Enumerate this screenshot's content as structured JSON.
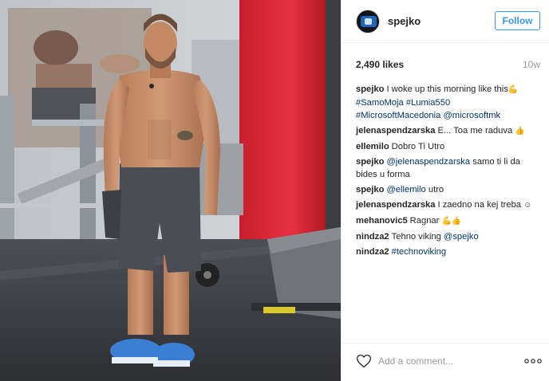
{
  "post": {
    "photo_alt": "",
    "author": {
      "username": "spejko",
      "avatar_icon": "profile-avatar"
    },
    "follow_label": "Follow",
    "likes": "2,490 likes",
    "time_ago": "10w",
    "caption": {
      "user": "spejko",
      "text": "I woke up this morning like this",
      "emoji": "💪",
      "tags": [
        "#SamoMoja",
        "#Lumia550",
        "#MicrosoftMacedonia",
        "@microsoftmk"
      ]
    },
    "comments": [
      {
        "user": "jelenaspendzarska",
        "text": "E... Toa me raduva",
        "emoji": "👍"
      },
      {
        "user": "ellemilo",
        "text": "Dobro Ti Utro"
      },
      {
        "user": "spejko",
        "mention": "@jelenaspendzarska",
        "text": "samo ti li da bides u forma"
      },
      {
        "user": "spejko",
        "mention": "@ellemilo",
        "text": "utro"
      },
      {
        "user": "jelenaspendzarska",
        "text": "I zaedno na kej treba",
        "emoji": "☺"
      },
      {
        "user": "mehanovic5",
        "text": "Ragnar",
        "emoji": "💪👍"
      },
      {
        "user": "nindza2",
        "text": "Tehno viking",
        "mention": "@spejko"
      },
      {
        "user": "nindza2",
        "mention": "#technoviking"
      }
    ],
    "add_comment_placeholder": "Add a comment...",
    "icons": {
      "like": "heart-outline-icon",
      "more": "more-options-icon"
    },
    "colors": {
      "accent": "#3897f0",
      "link": "#003569",
      "muted": "#999999",
      "text": "#262626"
    }
  }
}
